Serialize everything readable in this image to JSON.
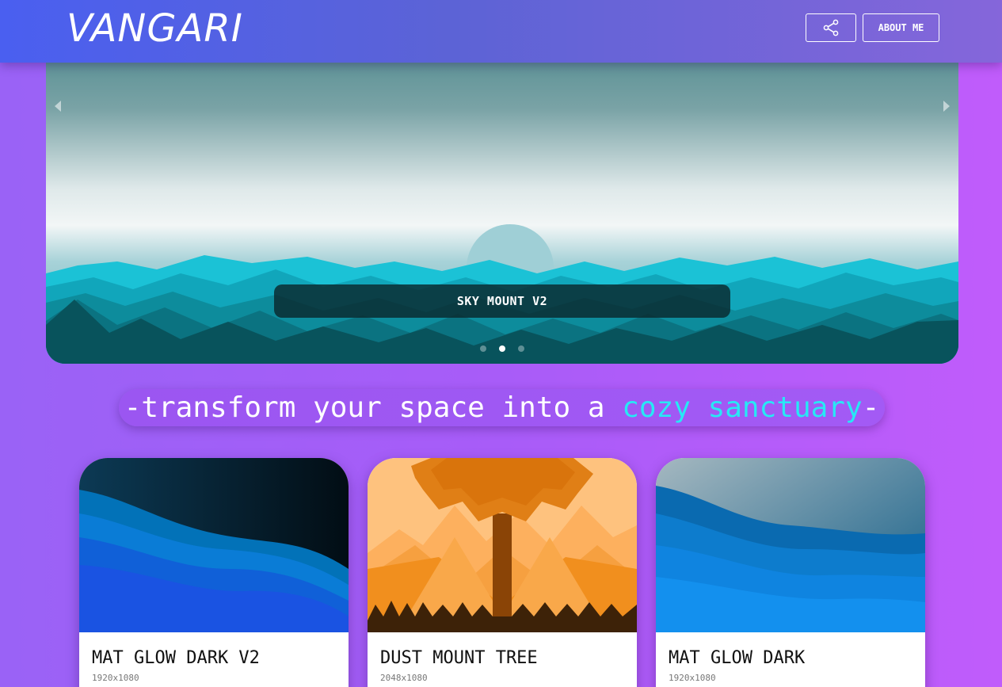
{
  "header": {
    "brand": "VANGARI",
    "about_label": "ABOUT ME",
    "share_icon": "share-icon"
  },
  "carousel": {
    "caption": "SKY MOUNT V2",
    "slides_total": 3,
    "active_slide": 2,
    "prev_icon": "chevron-left-icon",
    "next_icon": "chevron-right-icon"
  },
  "tagline": {
    "prefix": "-transform your space into a ",
    "accent": "cozy sanctuary",
    "suffix": "-"
  },
  "cards": [
    {
      "title": "MAT GLOW DARK V2",
      "resolution": "1920x1080"
    },
    {
      "title": "DUST MOUNT TREE",
      "resolution": "2048x1080"
    },
    {
      "title": "MAT GLOW DARK",
      "resolution": "1920x1080"
    }
  ],
  "colors": {
    "accent": "#27e8f5",
    "background": "#a85cf8",
    "header": "#5c63d6"
  }
}
